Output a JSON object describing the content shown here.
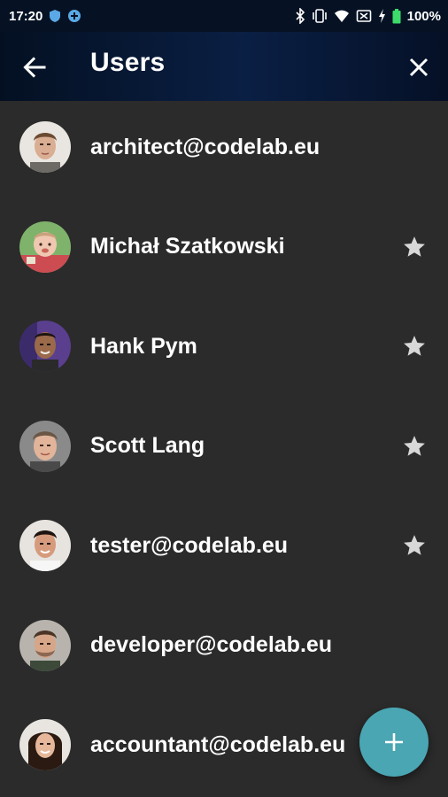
{
  "status_bar": {
    "time": "17:20",
    "battery": "100%",
    "icons": [
      "shield-icon",
      "vpn-icon",
      "bluetooth-icon",
      "vibrate-icon",
      "wifi-icon",
      "no-sim-icon",
      "charging-icon",
      "battery-icon"
    ]
  },
  "app_bar": {
    "title": "Users",
    "back_icon": "arrow-back-icon",
    "close_icon": "close-icon",
    "background": "#0a1f44"
  },
  "users": [
    {
      "name": "architect@codelab.eu",
      "starred": false
    },
    {
      "name": "Michał Szatkowski",
      "starred": true
    },
    {
      "name": "Hank Pym",
      "starred": true
    },
    {
      "name": "Scott Lang",
      "starred": true
    },
    {
      "name": "tester@codelab.eu",
      "starred": true
    },
    {
      "name": "developer@codelab.eu",
      "starred": false
    },
    {
      "name": "accountant@codelab.eu",
      "starred": false
    }
  ],
  "fab": {
    "icon": "plus-icon",
    "color": "#4aa6b3"
  },
  "colors": {
    "list_background": "#2b2b2b",
    "star": "#d8d8d8"
  }
}
